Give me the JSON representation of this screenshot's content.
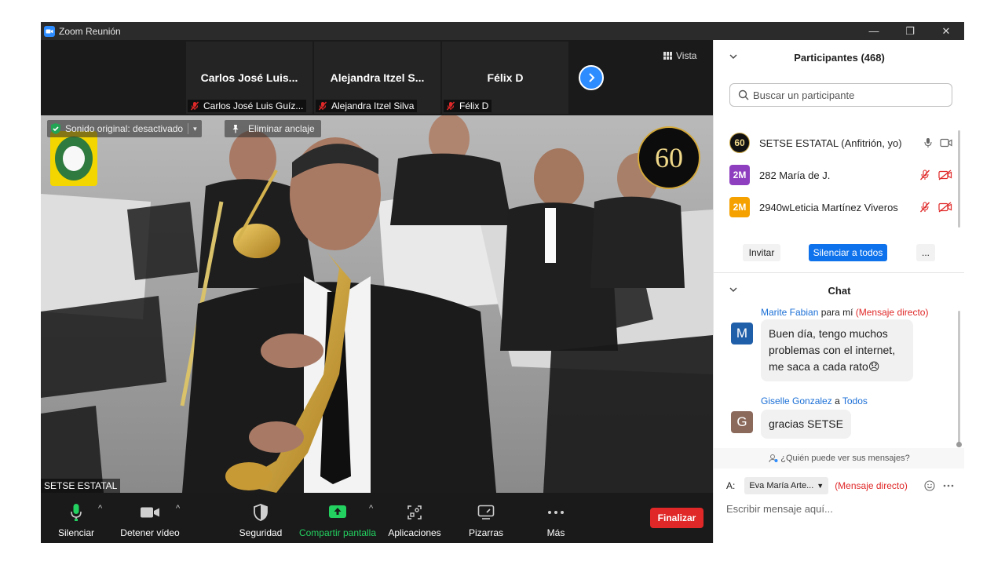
{
  "window": {
    "title": "Zoom Reunión",
    "minimize": "—",
    "restore": "❐",
    "close": "✕"
  },
  "strip": {
    "tiles": [
      {
        "name": "Carlos José Luis...",
        "label": "Carlos José Luis Guíz..."
      },
      {
        "name": "Alejandra Itzel S...",
        "label": "Alejandra Itzel Silva"
      },
      {
        "name": "Félix D",
        "label": "Félix D"
      }
    ],
    "view_label": "Vista"
  },
  "video": {
    "sound_label": "Sonido original: desactivado",
    "unpin_label": "Eliminar anclaje",
    "speaker_name": "SETSE ESTATAL",
    "logo_text": "60"
  },
  "toolbar": {
    "mute": "Silenciar",
    "stop_video": "Detener vídeo",
    "security": "Seguridad",
    "share": "Compartir pantalla",
    "apps": "Aplicaciones",
    "whiteboards": "Pizarras",
    "more": "Más",
    "end": "Finalizar"
  },
  "participants": {
    "title": "Participantes (468)",
    "search_placeholder": "Buscar un participante",
    "list": [
      {
        "avatar": "60",
        "name": "SETSE ESTATAL (Anfitrión, yo)",
        "color": "#111111"
      },
      {
        "avatar": "2M",
        "name": "282 María de J.",
        "color": "#8e3fbf"
      },
      {
        "avatar": "2M",
        "name": "2940wLeticia Martínez Viveros",
        "color": "#f5a100"
      }
    ],
    "invite": "Invitar",
    "mute_all": "Silenciar a todos",
    "more": "..."
  },
  "chat": {
    "title": "Chat",
    "messages": [
      {
        "sender": "Marite Fabian",
        "connector": "para mí",
        "target": "(Mensaje directo)",
        "avatar": "M",
        "avatar_color": "#1f5ea8",
        "lines": [
          "Buen día, tengo muchos",
          "problemas con el internet,",
          "me saca a cada rato"
        ],
        "emoji": "😞"
      },
      {
        "sender": "Giselle Gonzalez",
        "connector": "a",
        "target": "Todos",
        "avatar": "G",
        "avatar_color": "#8b6a5c",
        "lines": [
          "gracias SETSE"
        ]
      }
    ],
    "who_can_see": "¿Quién puede ver sus mensajes?",
    "to_label": "A:",
    "recipient": "Eva María Arte...",
    "direct_label": "(Mensaje directo)",
    "input_placeholder": "Escribir mensaje aquí..."
  }
}
